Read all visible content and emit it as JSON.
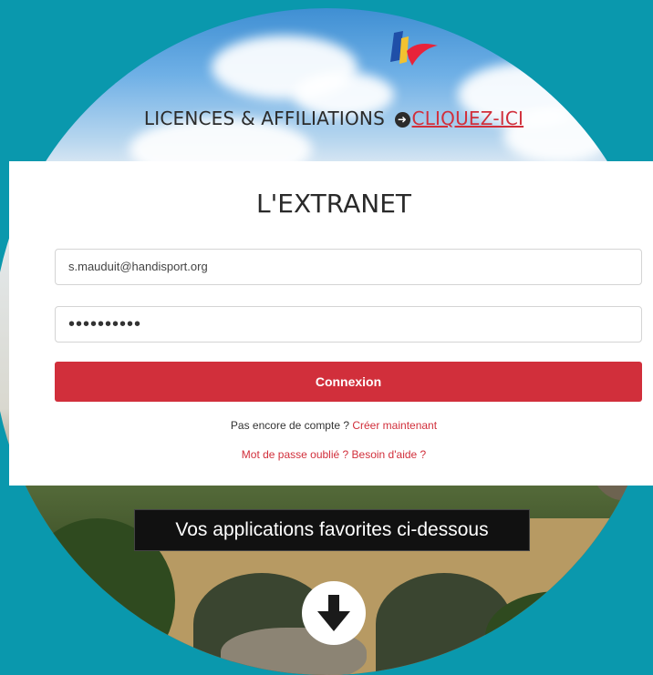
{
  "banner": {
    "text": "LICENCES & AFFILIATIONS",
    "link_label": "CLIQUEZ-ICI"
  },
  "login": {
    "title": "L'EXTRANET",
    "email_value": "s.mauduit@handisport.org",
    "password_value": "••••••••••",
    "submit_label": "Connexion",
    "no_account_text": "Pas encore de compte ?",
    "create_link": "Créer maintenant",
    "forgot_link": "Mot de passe oublié ? Besoin d'aide ?"
  },
  "favorites": {
    "caption": "Vos applications favorites ci-dessous"
  },
  "colors": {
    "accent": "#d12f3b",
    "background": "#0a98ad"
  },
  "icons": {
    "logo": "handisport-logo",
    "banner_arrow": "arrow-circle-right-icon",
    "scroll": "arrow-down-icon"
  }
}
